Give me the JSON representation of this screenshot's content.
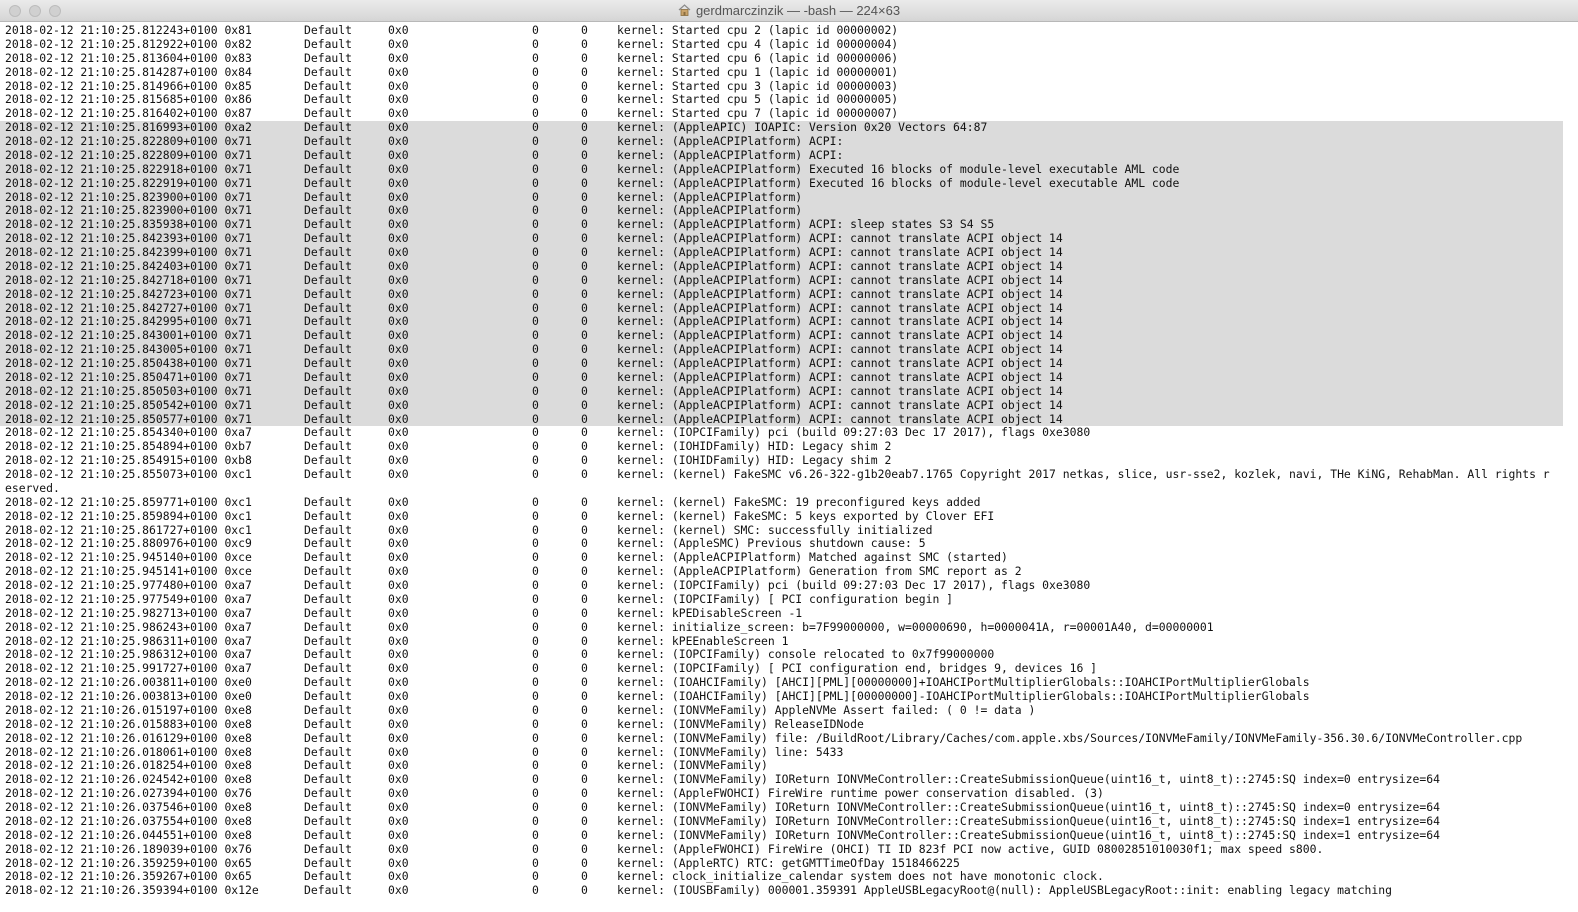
{
  "window": {
    "title": "gerdmarczinzik — -bash — 224×63"
  },
  "log": [
    {
      "ts": "2018-02-12 21:10:25.812243+0100 0x81",
      "type": "Default",
      "act": "0x0",
      "pid": "0",
      "ttl": "0",
      "msg": "kernel: Started cpu 2 (lapic id 00000002)",
      "sel": false
    },
    {
      "ts": "2018-02-12 21:10:25.812922+0100 0x82",
      "type": "Default",
      "act": "0x0",
      "pid": "0",
      "ttl": "0",
      "msg": "kernel: Started cpu 4 (lapic id 00000004)",
      "sel": false
    },
    {
      "ts": "2018-02-12 21:10:25.813604+0100 0x83",
      "type": "Default",
      "act": "0x0",
      "pid": "0",
      "ttl": "0",
      "msg": "kernel: Started cpu 6 (lapic id 00000006)",
      "sel": false
    },
    {
      "ts": "2018-02-12 21:10:25.814287+0100 0x84",
      "type": "Default",
      "act": "0x0",
      "pid": "0",
      "ttl": "0",
      "msg": "kernel: Started cpu 1 (lapic id 00000001)",
      "sel": false
    },
    {
      "ts": "2018-02-12 21:10:25.814966+0100 0x85",
      "type": "Default",
      "act": "0x0",
      "pid": "0",
      "ttl": "0",
      "msg": "kernel: Started cpu 3 (lapic id 00000003)",
      "sel": false
    },
    {
      "ts": "2018-02-12 21:10:25.815685+0100 0x86",
      "type": "Default",
      "act": "0x0",
      "pid": "0",
      "ttl": "0",
      "msg": "kernel: Started cpu 5 (lapic id 00000005)",
      "sel": false
    },
    {
      "ts": "2018-02-12 21:10:25.816402+0100 0x87",
      "type": "Default",
      "act": "0x0",
      "pid": "0",
      "ttl": "0",
      "msg": "kernel: Started cpu 7 (lapic id 00000007)",
      "sel": false
    },
    {
      "ts": "2018-02-12 21:10:25.816993+0100 0xa2",
      "type": "Default",
      "act": "0x0",
      "pid": "0",
      "ttl": "0",
      "msg": "kernel: (AppleAPIC) IOAPIC: Version 0x20 Vectors 64:87",
      "sel": true
    },
    {
      "ts": "2018-02-12 21:10:25.822809+0100 0x71",
      "type": "Default",
      "act": "0x0",
      "pid": "0",
      "ttl": "0",
      "msg": "kernel: (AppleACPIPlatform) ACPI:",
      "sel": true
    },
    {
      "ts": "2018-02-12 21:10:25.822809+0100 0x71",
      "type": "Default",
      "act": "0x0",
      "pid": "0",
      "ttl": "0",
      "msg": "kernel: (AppleACPIPlatform) ACPI:",
      "sel": true
    },
    {
      "ts": "2018-02-12 21:10:25.822918+0100 0x71",
      "type": "Default",
      "act": "0x0",
      "pid": "0",
      "ttl": "0",
      "msg": "kernel: (AppleACPIPlatform) Executed 16 blocks of module-level executable AML code",
      "sel": true
    },
    {
      "ts": "2018-02-12 21:10:25.822919+0100 0x71",
      "type": "Default",
      "act": "0x0",
      "pid": "0",
      "ttl": "0",
      "msg": "kernel: (AppleACPIPlatform) Executed 16 blocks of module-level executable AML code",
      "sel": true
    },
    {
      "ts": "2018-02-12 21:10:25.823900+0100 0x71",
      "type": "Default",
      "act": "0x0",
      "pid": "0",
      "ttl": "0",
      "msg": "kernel: (AppleACPIPlatform)",
      "sel": true
    },
    {
      "ts": "2018-02-12 21:10:25.823900+0100 0x71",
      "type": "Default",
      "act": "0x0",
      "pid": "0",
      "ttl": "0",
      "msg": "kernel: (AppleACPIPlatform)",
      "sel": true
    },
    {
      "ts": "2018-02-12 21:10:25.835938+0100 0x71",
      "type": "Default",
      "act": "0x0",
      "pid": "0",
      "ttl": "0",
      "msg": "kernel: (AppleACPIPlatform) ACPI: sleep states S3 S4 S5",
      "sel": true
    },
    {
      "ts": "2018-02-12 21:10:25.842393+0100 0x71",
      "type": "Default",
      "act": "0x0",
      "pid": "0",
      "ttl": "0",
      "msg": "kernel: (AppleACPIPlatform) ACPI: cannot translate ACPI object 14",
      "sel": true
    },
    {
      "ts": "2018-02-12 21:10:25.842399+0100 0x71",
      "type": "Default",
      "act": "0x0",
      "pid": "0",
      "ttl": "0",
      "msg": "kernel: (AppleACPIPlatform) ACPI: cannot translate ACPI object 14",
      "sel": true
    },
    {
      "ts": "2018-02-12 21:10:25.842403+0100 0x71",
      "type": "Default",
      "act": "0x0",
      "pid": "0",
      "ttl": "0",
      "msg": "kernel: (AppleACPIPlatform) ACPI: cannot translate ACPI object 14",
      "sel": true
    },
    {
      "ts": "2018-02-12 21:10:25.842718+0100 0x71",
      "type": "Default",
      "act": "0x0",
      "pid": "0",
      "ttl": "0",
      "msg": "kernel: (AppleACPIPlatform) ACPI: cannot translate ACPI object 14",
      "sel": true
    },
    {
      "ts": "2018-02-12 21:10:25.842723+0100 0x71",
      "type": "Default",
      "act": "0x0",
      "pid": "0",
      "ttl": "0",
      "msg": "kernel: (AppleACPIPlatform) ACPI: cannot translate ACPI object 14",
      "sel": true
    },
    {
      "ts": "2018-02-12 21:10:25.842727+0100 0x71",
      "type": "Default",
      "act": "0x0",
      "pid": "0",
      "ttl": "0",
      "msg": "kernel: (AppleACPIPlatform) ACPI: cannot translate ACPI object 14",
      "sel": true
    },
    {
      "ts": "2018-02-12 21:10:25.842995+0100 0x71",
      "type": "Default",
      "act": "0x0",
      "pid": "0",
      "ttl": "0",
      "msg": "kernel: (AppleACPIPlatform) ACPI: cannot translate ACPI object 14",
      "sel": true
    },
    {
      "ts": "2018-02-12 21:10:25.843001+0100 0x71",
      "type": "Default",
      "act": "0x0",
      "pid": "0",
      "ttl": "0",
      "msg": "kernel: (AppleACPIPlatform) ACPI: cannot translate ACPI object 14",
      "sel": true
    },
    {
      "ts": "2018-02-12 21:10:25.843005+0100 0x71",
      "type": "Default",
      "act": "0x0",
      "pid": "0",
      "ttl": "0",
      "msg": "kernel: (AppleACPIPlatform) ACPI: cannot translate ACPI object 14",
      "sel": true
    },
    {
      "ts": "2018-02-12 21:10:25.850438+0100 0x71",
      "type": "Default",
      "act": "0x0",
      "pid": "0",
      "ttl": "0",
      "msg": "kernel: (AppleACPIPlatform) ACPI: cannot translate ACPI object 14",
      "sel": true
    },
    {
      "ts": "2018-02-12 21:10:25.850471+0100 0x71",
      "type": "Default",
      "act": "0x0",
      "pid": "0",
      "ttl": "0",
      "msg": "kernel: (AppleACPIPlatform) ACPI: cannot translate ACPI object 14",
      "sel": true
    },
    {
      "ts": "2018-02-12 21:10:25.850503+0100 0x71",
      "type": "Default",
      "act": "0x0",
      "pid": "0",
      "ttl": "0",
      "msg": "kernel: (AppleACPIPlatform) ACPI: cannot translate ACPI object 14",
      "sel": true
    },
    {
      "ts": "2018-02-12 21:10:25.850542+0100 0x71",
      "type": "Default",
      "act": "0x0",
      "pid": "0",
      "ttl": "0",
      "msg": "kernel: (AppleACPIPlatform) ACPI: cannot translate ACPI object 14",
      "sel": true
    },
    {
      "ts": "2018-02-12 21:10:25.850577+0100 0x71",
      "type": "Default",
      "act": "0x0",
      "pid": "0",
      "ttl": "0",
      "msg": "kernel: (AppleACPIPlatform) ACPI: cannot translate ACPI object 14",
      "sel": true
    },
    {
      "ts": "2018-02-12 21:10:25.854340+0100 0xa7",
      "type": "Default",
      "act": "0x0",
      "pid": "0",
      "ttl": "0",
      "msg": "kernel: (IOPCIFamily) pci (build 09:27:03 Dec 17 2017), flags 0xe3080",
      "sel": false
    },
    {
      "ts": "2018-02-12 21:10:25.854894+0100 0xb7",
      "type": "Default",
      "act": "0x0",
      "pid": "0",
      "ttl": "0",
      "msg": "kernel: (IOHIDFamily) HID: Legacy shim 2",
      "sel": false
    },
    {
      "ts": "2018-02-12 21:10:25.854915+0100 0xb8",
      "type": "Default",
      "act": "0x0",
      "pid": "0",
      "ttl": "0",
      "msg": "kernel: (IOHIDFamily) HID: Legacy shim 2",
      "sel": false
    },
    {
      "ts": "2018-02-12 21:10:25.855073+0100 0xc1",
      "type": "Default",
      "act": "0x0",
      "pid": "0",
      "ttl": "0",
      "msg": "kernel: (kernel) FakeSMC v6.26-322-g1b20eab7.1765 Copyright 2017 netkas, slice, usr-sse2, kozlek, navi, THe KiNG, RehabMan. All rights r",
      "sel": false
    },
    {
      "wrap": "eserved."
    },
    {
      "ts": "2018-02-12 21:10:25.859771+0100 0xc1",
      "type": "Default",
      "act": "0x0",
      "pid": "0",
      "ttl": "0",
      "msg": "kernel: (kernel) FakeSMC: 19 preconfigured keys added",
      "sel": false
    },
    {
      "ts": "2018-02-12 21:10:25.859894+0100 0xc1",
      "type": "Default",
      "act": "0x0",
      "pid": "0",
      "ttl": "0",
      "msg": "kernel: (kernel) FakeSMC: 5 keys exported by Clover EFI",
      "sel": false
    },
    {
      "ts": "2018-02-12 21:10:25.861727+0100 0xc1",
      "type": "Default",
      "act": "0x0",
      "pid": "0",
      "ttl": "0",
      "msg": "kernel: (kernel) SMC: successfully initialized",
      "sel": false
    },
    {
      "ts": "2018-02-12 21:10:25.880976+0100 0xc9",
      "type": "Default",
      "act": "0x0",
      "pid": "0",
      "ttl": "0",
      "msg": "kernel: (AppleSMC) Previous shutdown cause: 5",
      "sel": false
    },
    {
      "ts": "2018-02-12 21:10:25.945140+0100 0xce",
      "type": "Default",
      "act": "0x0",
      "pid": "0",
      "ttl": "0",
      "msg": "kernel: (AppleACPIPlatform) Matched against SMC (started)",
      "sel": false
    },
    {
      "ts": "2018-02-12 21:10:25.945141+0100 0xce",
      "type": "Default",
      "act": "0x0",
      "pid": "0",
      "ttl": "0",
      "msg": "kernel: (AppleACPIPlatform) Generation from SMC report as 2",
      "sel": false
    },
    {
      "ts": "2018-02-12 21:10:25.977480+0100 0xa7",
      "type": "Default",
      "act": "0x0",
      "pid": "0",
      "ttl": "0",
      "msg": "kernel: (IOPCIFamily) pci (build 09:27:03 Dec 17 2017), flags 0xe3080",
      "sel": false
    },
    {
      "ts": "2018-02-12 21:10:25.977549+0100 0xa7",
      "type": "Default",
      "act": "0x0",
      "pid": "0",
      "ttl": "0",
      "msg": "kernel: (IOPCIFamily) [ PCI configuration begin ]",
      "sel": false
    },
    {
      "ts": "2018-02-12 21:10:25.982713+0100 0xa7",
      "type": "Default",
      "act": "0x0",
      "pid": "0",
      "ttl": "0",
      "msg": "kernel: kPEDisableScreen -1",
      "sel": false
    },
    {
      "ts": "2018-02-12 21:10:25.986243+0100 0xa7",
      "type": "Default",
      "act": "0x0",
      "pid": "0",
      "ttl": "0",
      "msg": "kernel: initialize_screen: b=7F99000000, w=00000690, h=0000041A, r=00001A40, d=00000001",
      "sel": false
    },
    {
      "ts": "2018-02-12 21:10:25.986311+0100 0xa7",
      "type": "Default",
      "act": "0x0",
      "pid": "0",
      "ttl": "0",
      "msg": "kernel: kPEEnableScreen 1",
      "sel": false
    },
    {
      "ts": "2018-02-12 21:10:25.986312+0100 0xa7",
      "type": "Default",
      "act": "0x0",
      "pid": "0",
      "ttl": "0",
      "msg": "kernel: (IOPCIFamily) console relocated to 0x7f99000000",
      "sel": false
    },
    {
      "ts": "2018-02-12 21:10:25.991727+0100 0xa7",
      "type": "Default",
      "act": "0x0",
      "pid": "0",
      "ttl": "0",
      "msg": "kernel: (IOPCIFamily) [ PCI configuration end, bridges 9, devices 16 ]",
      "sel": false
    },
    {
      "ts": "2018-02-12 21:10:26.003811+0100 0xe0",
      "type": "Default",
      "act": "0x0",
      "pid": "0",
      "ttl": "0",
      "msg": "kernel: (IOAHCIFamily) [AHCI][PML][00000000]+IOAHCIPortMultiplierGlobals::IOAHCIPortMultiplierGlobals",
      "sel": false
    },
    {
      "ts": "2018-02-12 21:10:26.003813+0100 0xe0",
      "type": "Default",
      "act": "0x0",
      "pid": "0",
      "ttl": "0",
      "msg": "kernel: (IOAHCIFamily) [AHCI][PML][00000000]-IOAHCIPortMultiplierGlobals::IOAHCIPortMultiplierGlobals",
      "sel": false
    },
    {
      "ts": "2018-02-12 21:10:26.015197+0100 0xe8",
      "type": "Default",
      "act": "0x0",
      "pid": "0",
      "ttl": "0",
      "msg": "kernel: (IONVMeFamily) AppleNVMe Assert failed: ( 0 != data )",
      "sel": false
    },
    {
      "ts": "2018-02-12 21:10:26.015883+0100 0xe8",
      "type": "Default",
      "act": "0x0",
      "pid": "0",
      "ttl": "0",
      "msg": "kernel: (IONVMeFamily) ReleaseIDNode",
      "sel": false
    },
    {
      "ts": "2018-02-12 21:10:26.016129+0100 0xe8",
      "type": "Default",
      "act": "0x0",
      "pid": "0",
      "ttl": "0",
      "msg": "kernel: (IONVMeFamily) file: /BuildRoot/Library/Caches/com.apple.xbs/Sources/IONVMeFamily/IONVMeFamily-356.30.6/IONVMeController.cpp",
      "sel": false
    },
    {
      "ts": "2018-02-12 21:10:26.018061+0100 0xe8",
      "type": "Default",
      "act": "0x0",
      "pid": "0",
      "ttl": "0",
      "msg": "kernel: (IONVMeFamily) line: 5433",
      "sel": false
    },
    {
      "ts": "2018-02-12 21:10:26.018254+0100 0xe8",
      "type": "Default",
      "act": "0x0",
      "pid": "0",
      "ttl": "0",
      "msg": "kernel: (IONVMeFamily)",
      "sel": false
    },
    {
      "ts": "2018-02-12 21:10:26.024542+0100 0xe8",
      "type": "Default",
      "act": "0x0",
      "pid": "0",
      "ttl": "0",
      "msg": "kernel: (IONVMeFamily) IOReturn IONVMeController::CreateSubmissionQueue(uint16_t, uint8_t)::2745:SQ index=0 entrysize=64",
      "sel": false
    },
    {
      "ts": "2018-02-12 21:10:26.027394+0100 0x76",
      "type": "Default",
      "act": "0x0",
      "pid": "0",
      "ttl": "0",
      "msg": "kernel: (AppleFWOHCI) FireWire runtime power conservation disabled. (3)",
      "sel": false
    },
    {
      "ts": "2018-02-12 21:10:26.037546+0100 0xe8",
      "type": "Default",
      "act": "0x0",
      "pid": "0",
      "ttl": "0",
      "msg": "kernel: (IONVMeFamily) IOReturn IONVMeController::CreateSubmissionQueue(uint16_t, uint8_t)::2745:SQ index=0 entrysize=64",
      "sel": false
    },
    {
      "ts": "2018-02-12 21:10:26.037554+0100 0xe8",
      "type": "Default",
      "act": "0x0",
      "pid": "0",
      "ttl": "0",
      "msg": "kernel: (IONVMeFamily) IOReturn IONVMeController::CreateSubmissionQueue(uint16_t, uint8_t)::2745:SQ index=1 entrysize=64",
      "sel": false
    },
    {
      "ts": "2018-02-12 21:10:26.044551+0100 0xe8",
      "type": "Default",
      "act": "0x0",
      "pid": "0",
      "ttl": "0",
      "msg": "kernel: (IONVMeFamily) IOReturn IONVMeController::CreateSubmissionQueue(uint16_t, uint8_t)::2745:SQ index=1 entrysize=64",
      "sel": false
    },
    {
      "ts": "2018-02-12 21:10:26.189039+0100 0x76",
      "type": "Default",
      "act": "0x0",
      "pid": "0",
      "ttl": "0",
      "msg": "kernel: (AppleFWOHCI) FireWire (OHCI) TI ID 823f PCI now active, GUID 08002851010030f1; max speed s800.",
      "sel": false
    },
    {
      "ts": "2018-02-12 21:10:26.359259+0100 0x65",
      "type": "Default",
      "act": "0x0",
      "pid": "0",
      "ttl": "0",
      "msg": "kernel: (AppleRTC) RTC: getGMTTimeOfDay 1518466225",
      "sel": false
    },
    {
      "ts": "2018-02-12 21:10:26.359267+0100 0x65",
      "type": "Default",
      "act": "0x0",
      "pid": "0",
      "ttl": "0",
      "msg": "kernel: clock_initialize_calendar system does not have monotonic clock.",
      "sel": false
    },
    {
      "ts": "2018-02-12 21:10:26.359394+0100 0x12e",
      "type": "Default",
      "act": "0x0",
      "pid": "0",
      "ttl": "0",
      "msg": "kernel: (IOUSBFamily) 000001.359391 AppleUSBLegacyRoot@(null): AppleUSBLegacyRoot::init: enabling legacy matching",
      "sel": false
    }
  ]
}
